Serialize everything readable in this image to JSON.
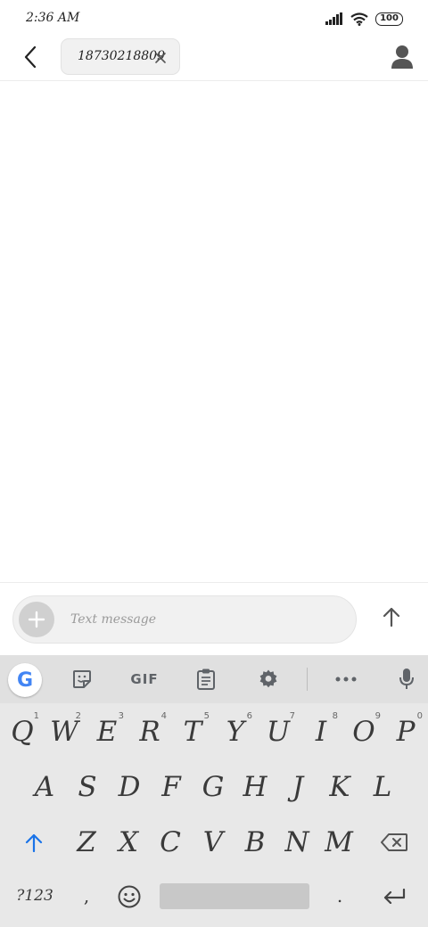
{
  "status_bar": {
    "time": "2:36 AM",
    "battery": "100"
  },
  "top_bar": {
    "recipient": "18730218809"
  },
  "compose": {
    "placeholder": "Text message"
  },
  "keyboard": {
    "toolbar": {
      "gif_label": "GIF"
    },
    "rows": [
      [
        {
          "label": "Q",
          "hint": "1"
        },
        {
          "label": "W",
          "hint": "2"
        },
        {
          "label": "E",
          "hint": "3"
        },
        {
          "label": "R",
          "hint": "4"
        },
        {
          "label": "T",
          "hint": "5"
        },
        {
          "label": "Y",
          "hint": "6"
        },
        {
          "label": "U",
          "hint": "7"
        },
        {
          "label": "I",
          "hint": "8"
        },
        {
          "label": "O",
          "hint": "9"
        },
        {
          "label": "P",
          "hint": "0"
        }
      ],
      [
        {
          "label": "A"
        },
        {
          "label": "S"
        },
        {
          "label": "D"
        },
        {
          "label": "F"
        },
        {
          "label": "G"
        },
        {
          "label": "H"
        },
        {
          "label": "J"
        },
        {
          "label": "K"
        },
        {
          "label": "L"
        }
      ],
      [
        {
          "label": "Z"
        },
        {
          "label": "X"
        },
        {
          "label": "C"
        },
        {
          "label": "V"
        },
        {
          "label": "B"
        },
        {
          "label": "N"
        },
        {
          "label": "M"
        }
      ]
    ],
    "symbols_label": "?123",
    "comma_label": ",",
    "period_label": "."
  },
  "colors": {
    "accent": "#1a73e8",
    "keyboard_bg": "#e8e8e8",
    "toolbar_bg": "#e0e0e0"
  }
}
